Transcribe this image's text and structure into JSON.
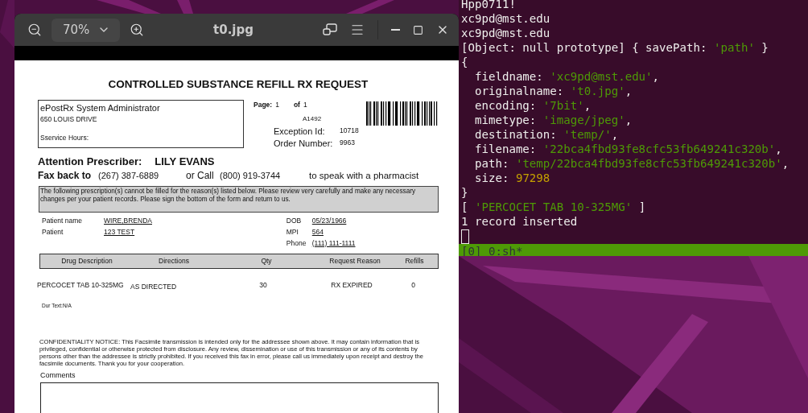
{
  "viewer": {
    "title": "t0.jpg",
    "zoom": "70%"
  },
  "document": {
    "title": "CONTROLLED SUBSTANCE REFILL RX REQUEST",
    "sender": [
      "ePostRx System Administrator",
      "650 LOUIS DRIVE",
      "Sservice Hours:"
    ],
    "page_label": "Page:",
    "page": "1",
    "of_label": "of",
    "of": "1",
    "code": "A1492",
    "exception_label": "Exception Id:",
    "exception_id": "10718",
    "order_label": "Order Number:",
    "order_number": "9963",
    "attention_label": "Attention Prescriber:",
    "prescriber": "LILY EVANS",
    "fax_label": "Fax back to",
    "fax": "(267) 387-6889",
    "call_label": "or Call",
    "call": "(800) 919-3744",
    "speak": "to speak with a pharmacist",
    "notice": "The following prescription(s) cannot be filled for the reason(s) listed below.  Please review very carefully and make any necessary changes per your patient records. Please sign the bottom of the form and return to us.",
    "patient_left": [
      {
        "label": "Patient name",
        "value": "WIRE,BRENDA"
      },
      {
        "label": "Patient",
        "value": "123 TEST"
      }
    ],
    "patient_right": [
      {
        "label": "DOB",
        "value": "05/23/1966"
      },
      {
        "label": "MPI",
        "value": "564"
      },
      {
        "label": "Phone",
        "value": "(111) 111-1111"
      }
    ],
    "table": {
      "columns": [
        "Drug Description",
        "Directions",
        "Qty",
        "Request Reason",
        "Refills"
      ],
      "rows": [
        [
          "PERCOCET TAB 10-325MG",
          "AS DIRECTED",
          "30",
          "RX EXPIRED",
          "0"
        ]
      ]
    },
    "dur_text": "Dur Text:N/A",
    "confidentiality": "CONFIDENTIALITY NOTICE: This Facsimile transmission is intended only for the addressee shown above. It may contain information that is privileged, confidential or otherwise protected from disclosure. Any review, dissemination or use of this transmission or any of its contents by persons other than the addressee is strictly prohibited. If you received this fax in error, please call us immediately upon receipt and destroy the facsimile documents. Thank you for your cooperation.",
    "comments_label": "Comments"
  },
  "terminal": {
    "lines": [
      {
        "segments": [
          {
            "text": "Hpp0711!",
            "kind": "plain"
          }
        ]
      },
      {
        "segments": [
          {
            "text": "xc9pd@mst.edu",
            "kind": "plain"
          }
        ]
      },
      {
        "segments": [
          {
            "text": "xc9pd@mst.edu",
            "kind": "plain"
          }
        ]
      },
      {
        "segments": [
          {
            "text": "[Object: null prototype] { savePath: ",
            "kind": "plain"
          },
          {
            "text": "'path'",
            "kind": "string"
          },
          {
            "text": " }",
            "kind": "plain"
          }
        ]
      },
      {
        "segments": [
          {
            "text": "{",
            "kind": "plain"
          }
        ]
      },
      {
        "segments": [
          {
            "text": "  fieldname: ",
            "kind": "plain"
          },
          {
            "text": "'xc9pd@mst.edu'",
            "kind": "string"
          },
          {
            "text": ",",
            "kind": "plain"
          }
        ]
      },
      {
        "segments": [
          {
            "text": "  originalname: ",
            "kind": "plain"
          },
          {
            "text": "'t0.jpg'",
            "kind": "string"
          },
          {
            "text": ",",
            "kind": "plain"
          }
        ]
      },
      {
        "segments": [
          {
            "text": "  encoding: ",
            "kind": "plain"
          },
          {
            "text": "'7bit'",
            "kind": "string"
          },
          {
            "text": ",",
            "kind": "plain"
          }
        ]
      },
      {
        "segments": [
          {
            "text": "  mimetype: ",
            "kind": "plain"
          },
          {
            "text": "'image/jpeg'",
            "kind": "string"
          },
          {
            "text": ",",
            "kind": "plain"
          }
        ]
      },
      {
        "segments": [
          {
            "text": "  destination: ",
            "kind": "plain"
          },
          {
            "text": "'temp/'",
            "kind": "string"
          },
          {
            "text": ",",
            "kind": "plain"
          }
        ]
      },
      {
        "segments": [
          {
            "text": "  filename: ",
            "kind": "plain"
          },
          {
            "text": "'22bca4fbd93fe8cfc53fb649241c320b'",
            "kind": "string"
          },
          {
            "text": ",",
            "kind": "plain"
          }
        ]
      },
      {
        "segments": [
          {
            "text": "  path: ",
            "kind": "plain"
          },
          {
            "text": "'temp/22bca4fbd93fe8cfc53fb649241c320b'",
            "kind": "string"
          },
          {
            "text": ",",
            "kind": "plain"
          }
        ]
      },
      {
        "segments": [
          {
            "text": "  size: ",
            "kind": "plain"
          },
          {
            "text": "97298",
            "kind": "number"
          }
        ]
      },
      {
        "segments": [
          {
            "text": "}",
            "kind": "plain"
          }
        ]
      },
      {
        "segments": [
          {
            "text": "[ ",
            "kind": "plain"
          },
          {
            "text": "'PERCOCET TAB 10-325MG'",
            "kind": "string"
          },
          {
            "text": " ]",
            "kind": "plain"
          }
        ]
      },
      {
        "segments": [
          {
            "text": "1 record inserted",
            "kind": "plain"
          }
        ]
      }
    ],
    "status": "[0] 0:sh*"
  }
}
